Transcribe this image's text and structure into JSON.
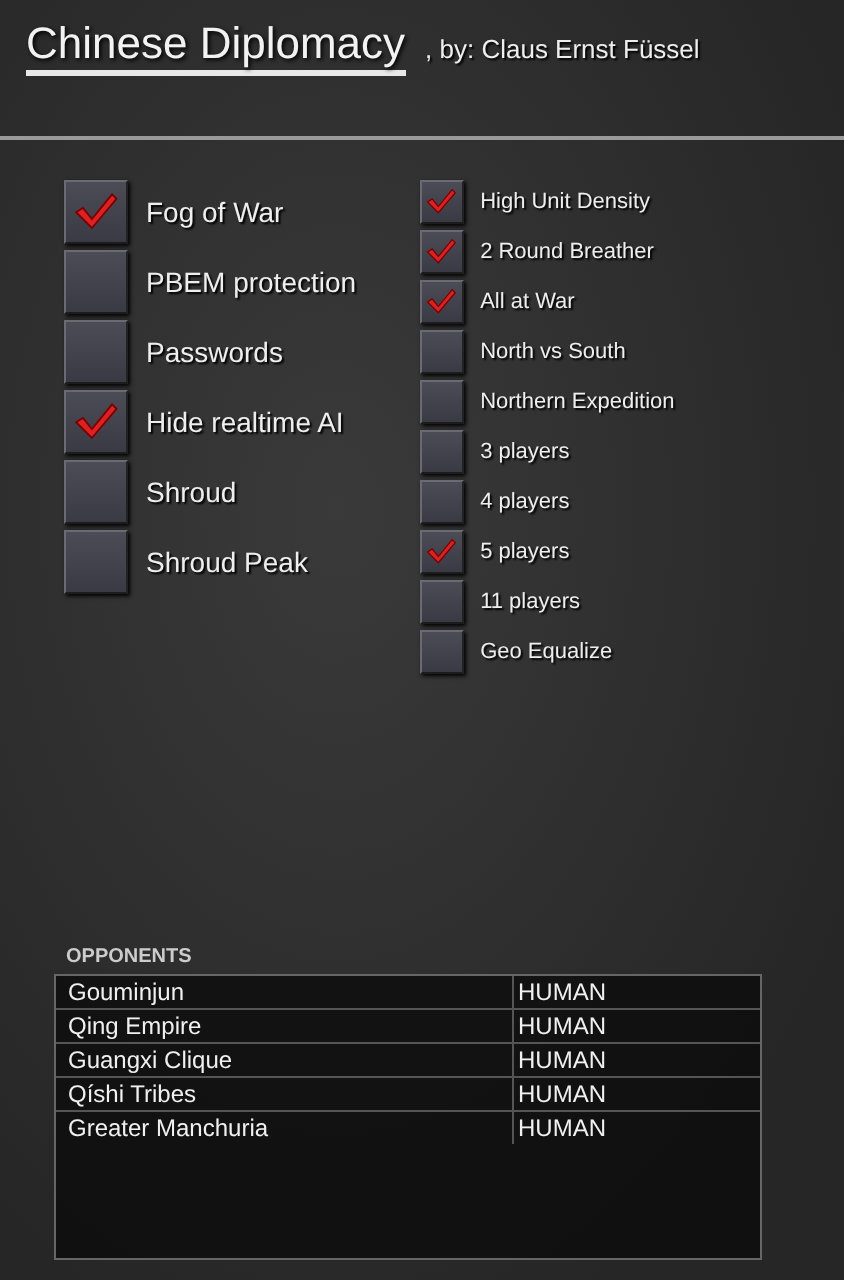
{
  "header": {
    "title": "Chinese Diplomacy",
    "author": ", by: Claus Ernst Füssel"
  },
  "main_options": [
    {
      "label": "Fog of War",
      "checked": true
    },
    {
      "label": "PBEM protection",
      "checked": false
    },
    {
      "label": "Passwords",
      "checked": false
    },
    {
      "label": "Hide realtime AI",
      "checked": true
    },
    {
      "label": "Shroud",
      "checked": false
    },
    {
      "label": "Shroud Peak",
      "checked": false
    }
  ],
  "scenario_options": [
    {
      "label": "High Unit Density",
      "checked": true
    },
    {
      "label": "2 Round Breather",
      "checked": true
    },
    {
      "label": "All at War",
      "checked": true
    },
    {
      "label": "North vs South",
      "checked": false
    },
    {
      "label": "Northern Expedition",
      "checked": false
    },
    {
      "label": "3 players",
      "checked": false
    },
    {
      "label": "4 players",
      "checked": false
    },
    {
      "label": "5 players",
      "checked": true
    },
    {
      "label": "11 players",
      "checked": false
    },
    {
      "label": "Geo Equalize",
      "checked": false
    }
  ],
  "opponents": {
    "heading": "OPPONENTS",
    "rows": [
      {
        "name": "Gouminjun",
        "type": "HUMAN"
      },
      {
        "name": "Qing Empire",
        "type": "HUMAN"
      },
      {
        "name": "Guangxi Clique",
        "type": "HUMAN"
      },
      {
        "name": "Qíshi Tribes",
        "type": "HUMAN"
      },
      {
        "name": "Greater Manchuria",
        "type": "HUMAN"
      }
    ]
  }
}
